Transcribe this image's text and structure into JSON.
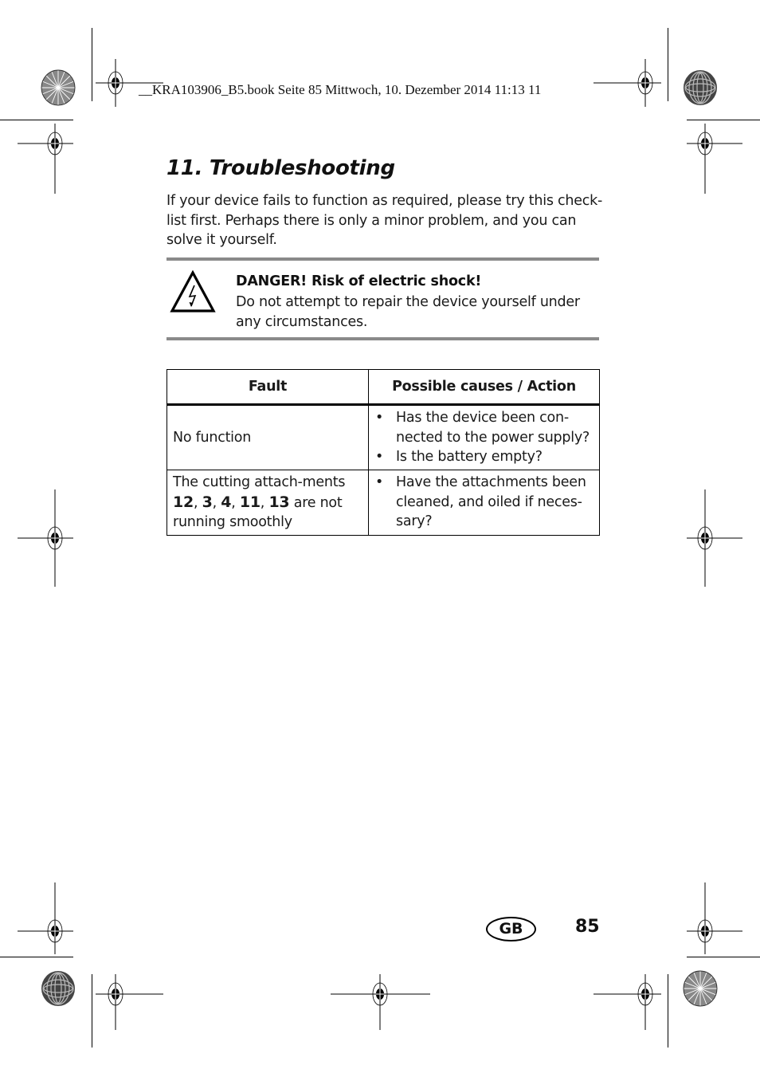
{
  "print_header": "__KRA103906_B5.book  Seite 85  Mittwoch, 10. Dezember 2014  11:13 11",
  "section": {
    "title": "11. Troubleshooting",
    "intro": "If your device fails to function as required, please try this check-list first. Perhaps there is only a minor problem, and you can solve it yourself."
  },
  "warning": {
    "icon": "electric-shock-warning-icon",
    "title": "DANGER! Risk of electric shock!",
    "text": "Do not attempt to repair the device yourself under any circumstances."
  },
  "table": {
    "headers": [
      "Fault",
      "Possible causes / Action"
    ],
    "rows": [
      {
        "fault": "No function",
        "causes": [
          "Has the device been con-nected to the power supply?",
          "Is the battery empty?"
        ]
      },
      {
        "fault_prefix": "The cutting attach-ments",
        "fault_numbers": [
          "12",
          "3",
          "4",
          "11",
          "13"
        ],
        "fault_suffix": "are not running smoothly",
        "causes": [
          "Have the attachments been cleaned, and oiled if neces-sary?"
        ]
      }
    ]
  },
  "footer": {
    "language_badge": "GB",
    "page_number": "85"
  }
}
